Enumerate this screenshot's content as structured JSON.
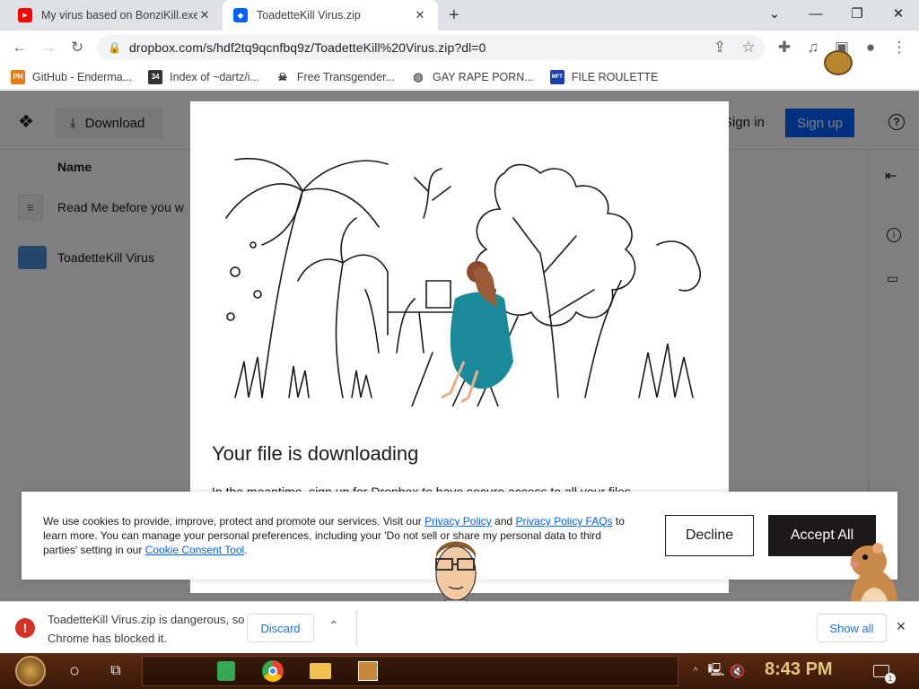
{
  "tabs": [
    {
      "title": "My virus based on BonziKill.exe"
    },
    {
      "title": "ToadetteKill Virus.zip"
    }
  ],
  "toolbar": {
    "url": "dropbox.com/s/hdf2tq9qcnfbq9z/ToadetteKill%20Virus.zip?dl=0"
  },
  "bookmarks": [
    {
      "label": "GitHub - Enderma...",
      "icon": "PH"
    },
    {
      "label": "Index of ~dartz/i...",
      "icon": "34"
    },
    {
      "label": "Free Transgender...",
      "icon": "skull"
    },
    {
      "label": "GAY RAPE PORN...",
      "icon": "globe"
    },
    {
      "label": "FILE ROULETTE",
      "icon": "MFT"
    }
  ],
  "dropbox": {
    "download_label": "Download",
    "signin_label": "Sign in",
    "signup_label": "Sign up",
    "column_name": "Name",
    "files": [
      {
        "name": "Read Me before you w"
      },
      {
        "name": "ToadetteKill Virus"
      }
    ]
  },
  "modal": {
    "heading": "Your file is downloading",
    "sub": "In the meantime, sign up for Dropbox to have secure access to all your files"
  },
  "cookie": {
    "text_1": "We use cookies to provide, improve, protect and promote our services. Visit our",
    "link_1": "Privacy Policy",
    "and": "and",
    "link_2": "Privacy Policy FAQs",
    "text_2": "to learn more. You can manage your personal preferences, including your 'Do not sell or share my personal data to third parties' setting in our",
    "link_3": "Cookie Consent Tool",
    "decline_label": "Decline",
    "accept_label": "Accept All"
  },
  "shelf": {
    "message": "ToadetteKill Virus.zip is dangerous, so Chrome has blocked it.",
    "discard_label": "Discard",
    "show_all_label": "Show all"
  },
  "taskbar": {
    "clock": "8:43 PM",
    "notification_count": "1"
  },
  "colors": {
    "dropbox_blue": "#0061fe",
    "chrome_tab_bg": "#dee1e6",
    "danger_red": "#d93025",
    "taskbar": "#4a2010"
  }
}
